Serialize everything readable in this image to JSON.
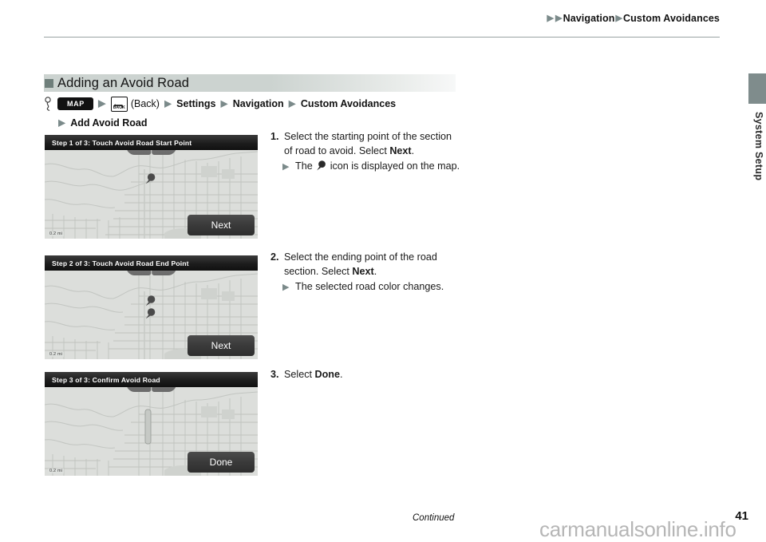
{
  "header": {
    "breadcrumb": [
      "Navigation",
      "Custom Avoidances"
    ],
    "side_label": "System Setup"
  },
  "section": {
    "heading": "Adding an Avoid Road",
    "nav_path_row1": {
      "map_button": "MAP",
      "back_button_label": "BACK",
      "back_text": "(Back)",
      "items": [
        "Settings",
        "Navigation",
        "Custom Avoidances"
      ]
    },
    "nav_path_row2": {
      "item": "Add Avoid Road"
    }
  },
  "steps": [
    {
      "number": "1.",
      "text_before": "Select the starting point of the section of road to avoid. Select ",
      "bold_word": "Next",
      "text_after": ".",
      "sub_before": "The ",
      "sub_after": " icon is displayed on the map."
    },
    {
      "number": "2.",
      "text_before": "Select the ending point of the road section. Select ",
      "bold_word": "Next",
      "text_after": ".",
      "sub_text": "The selected road color changes."
    },
    {
      "number": "3.",
      "text_before": "Select ",
      "bold_word": "Done",
      "text_after": "."
    }
  ],
  "screenshots": [
    {
      "title": "Step 1 of 3: Touch Avoid Road Start Point",
      "zoom_out": "−",
      "zoom_in": "+",
      "action_label": "Next",
      "scale": "0.2 mi",
      "pins": 1
    },
    {
      "title": "Step 2 of 3: Touch Avoid Road End Point",
      "zoom_out": "−",
      "zoom_in": "+",
      "action_label": "Next",
      "scale": "0.2 mi",
      "pins": 2
    },
    {
      "title": "Step 3 of 3: Confirm Avoid Road",
      "zoom_out": "−",
      "zoom_in": "+",
      "action_label": "Done",
      "scale": "0.2 mi",
      "pins": 0
    }
  ],
  "footer": {
    "continued": "Continued",
    "page_number": "41",
    "watermark": "carmanualsonline.info"
  },
  "colors": {
    "heading_bar": "#ccd3d0",
    "bullet": "#6f7f7b",
    "triangle": "#7b8a8a",
    "side_tab": "#7f8c8c",
    "map_bg": "#dcdedb",
    "button_dark": "#2e2e2e"
  }
}
